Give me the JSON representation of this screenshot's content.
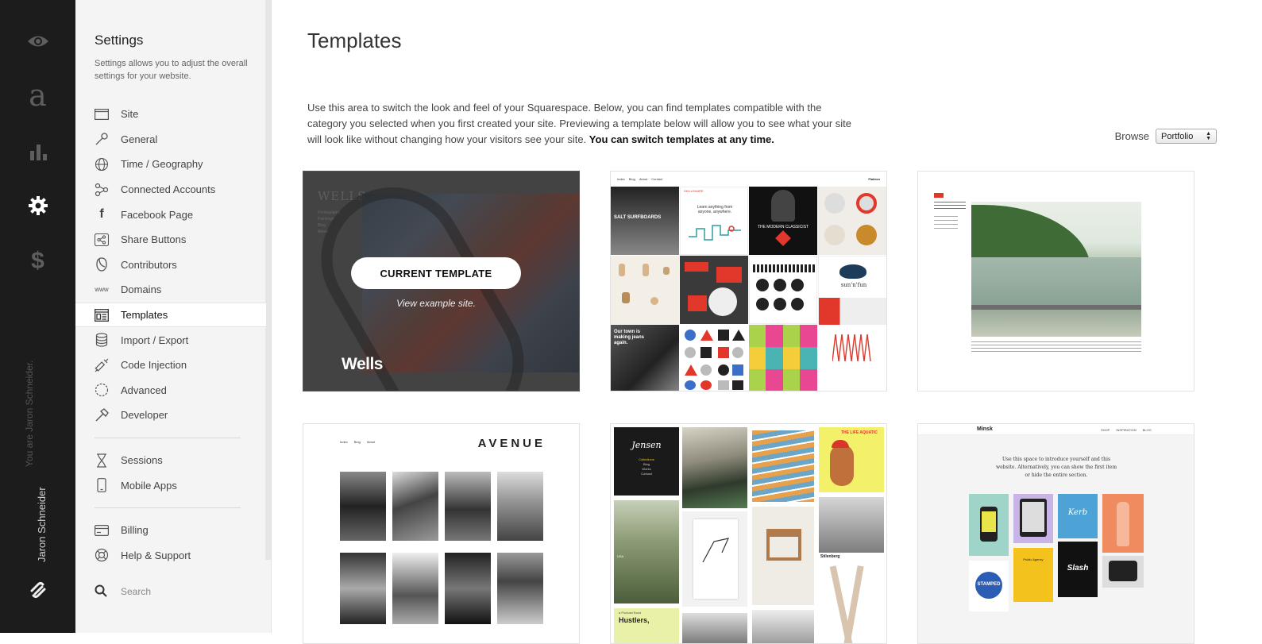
{
  "rail": {
    "user_label": "You are Jaron Schneider.",
    "user_name": "Jaron Schneider"
  },
  "settings": {
    "title": "Settings",
    "description": "Settings allows you to adjust the overall settings for your website.",
    "items": [
      {
        "label": "Site",
        "icon": "site-icon"
      },
      {
        "label": "General",
        "icon": "wrench-icon"
      },
      {
        "label": "Time / Geography",
        "icon": "globe-icon"
      },
      {
        "label": "Connected Accounts",
        "icon": "connected-accounts-icon"
      },
      {
        "label": "Facebook Page",
        "icon": "facebook-icon"
      },
      {
        "label": "Share Buttons",
        "icon": "share-icon"
      },
      {
        "label": "Contributors",
        "icon": "contributors-icon"
      },
      {
        "label": "Domains",
        "icon": "www-icon"
      },
      {
        "label": "Templates",
        "icon": "templates-icon"
      },
      {
        "label": "Import / Export",
        "icon": "database-icon"
      },
      {
        "label": "Code Injection",
        "icon": "syringe-icon"
      },
      {
        "label": "Advanced",
        "icon": "advanced-icon"
      },
      {
        "label": "Developer",
        "icon": "hammer-icon"
      },
      {
        "label": "Sessions",
        "icon": "hourglass-icon"
      },
      {
        "label": "Mobile Apps",
        "icon": "mobile-icon"
      },
      {
        "label": "Billing",
        "icon": "credit-card-icon"
      },
      {
        "label": "Help & Support",
        "icon": "lifebuoy-icon"
      }
    ],
    "search_placeholder": "Search"
  },
  "main": {
    "title": "Templates",
    "intro": "Use this area to switch the look and feel of your Squarespace. Below, you can find templates compatible with the category you selected when you first created your site. Previewing a template below will allow you to see what your site will look like without changing how your visitors see your site.",
    "intro_bold": "You can switch templates at any time.",
    "browse_label": "Browse",
    "browse_value": "Portfolio"
  },
  "templates": {
    "current_button": "CURRENT TEMPLATE",
    "view_example": "View example site.",
    "wells_name": "Wells",
    "wells_logo": "WELLS",
    "wells_nav": [
      "Photographs",
      "Paintings",
      "Blog",
      "About"
    ],
    "flatiron_nav": [
      "Index",
      "Blog",
      "About",
      "Contact"
    ],
    "flatiron_brand": "Flatiron",
    "flatiron_tiles": [
      "SALT SURFBOARDS",
      "SKILLSHARE",
      "Learn anything from anyone, anywhere.",
      "THE MODERN CLASSICIST",
      "sun'n'fun",
      "Our town is making jeans again."
    ],
    "avenue_logo": "AVENUE",
    "avenue_nav": [
      "Index",
      "Blog",
      "About"
    ],
    "jensen_logo": "Jensen",
    "jensen_nav": [
      "Collections",
      "Blog",
      "Works",
      "Contact"
    ],
    "jensen_tiles": [
      "THE LIFE AQUATIC",
      "USA",
      "Hustlers,",
      "a Podcast Band"
    ],
    "minsk_logo": "Minsk",
    "minsk_nav": [
      "SHOP",
      "INSPIRATION",
      "BLOG"
    ],
    "minsk_intro": "Use this space to introduce yourself and this website. Alternatively, you can show the first item or hide the entire section.",
    "minsk_tiles": [
      "Kerb",
      "Slash",
      "STAMPED",
      "Public Agency"
    ]
  },
  "colors": {
    "rail_bg": "#1c1c1c",
    "panel_bg": "#f4f4f4",
    "accent_red": "#e2382b"
  }
}
